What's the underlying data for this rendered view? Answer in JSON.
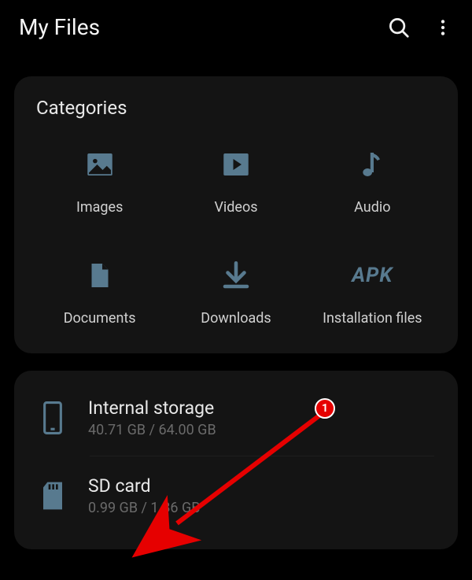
{
  "header": {
    "title": "My Files"
  },
  "categories": {
    "title": "Categories",
    "items": [
      {
        "label": "Images"
      },
      {
        "label": "Videos"
      },
      {
        "label": "Audio"
      },
      {
        "label": "Documents"
      },
      {
        "label": "Downloads"
      },
      {
        "label": "Installation files"
      }
    ]
  },
  "storage": {
    "internal": {
      "title": "Internal storage",
      "sub": "40.71 GB / 64.00 GB"
    },
    "sd": {
      "title": "SD card",
      "sub": "0.99 GB / 1.86 GB"
    }
  },
  "annotation": {
    "badge": "1"
  }
}
